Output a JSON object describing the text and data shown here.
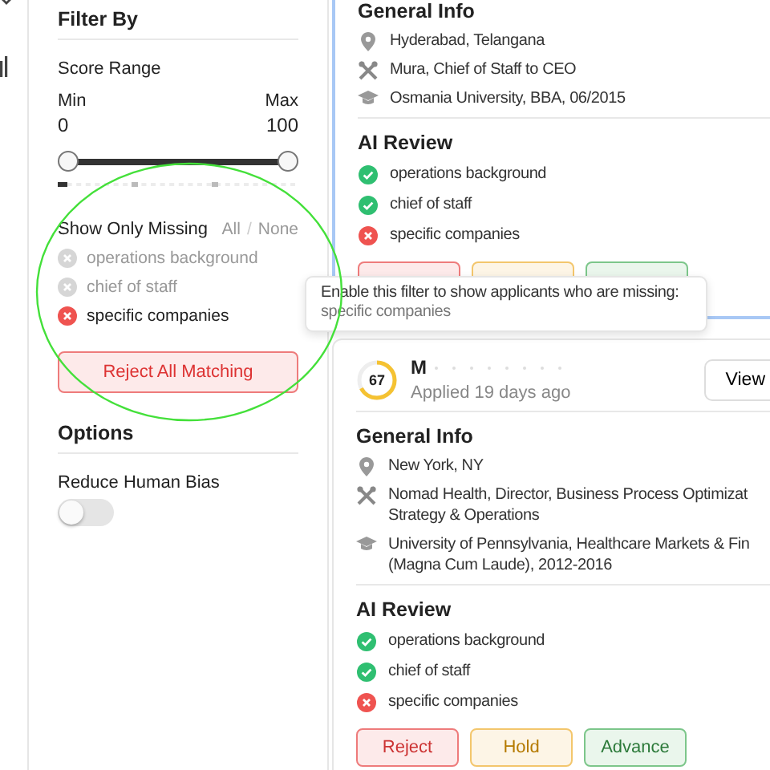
{
  "filter_panel": {
    "title": "Filter By",
    "score_range": {
      "label": "Score Range",
      "min_label": "Min",
      "max_label": "Max",
      "min_value": "0",
      "max_value": "100",
      "low_thumb": {
        "level": 0
      },
      "high_thumb": {
        "level": 1
      }
    },
    "missing_filter": {
      "label": "Show Only Missing",
      "all_link": "All",
      "separator": "/",
      "none_link": "None",
      "items": [
        {
          "label": "operations background",
          "selected": false
        },
        {
          "label": "chief of staff",
          "selected": false
        },
        {
          "label": "specific companies",
          "selected": true
        }
      ],
      "reject_button": "Reject All Matching"
    },
    "options": {
      "title": "Options",
      "toggles": [
        {
          "label": "Reduce Human Bias",
          "on": false
        }
      ]
    }
  },
  "tooltip": {
    "text": "Enable this filter to show applicants who are missing:",
    "detail": "specific companies"
  },
  "candidates": [
    {
      "selected": true,
      "general_info_title": "General Info",
      "info": [
        {
          "kind": "location",
          "lines": [
            "Hyderabad, Telangana"
          ]
        },
        {
          "kind": "work",
          "lines": [
            "Mura, Chief of Staff to CEO"
          ]
        },
        {
          "kind": "education",
          "lines": [
            "Osmania University, BBA, 06/2015"
          ]
        }
      ],
      "ai_review_title": "AI Review",
      "review": [
        {
          "label": "operations background",
          "passed": true
        },
        {
          "label": "chief of staff",
          "passed": true
        },
        {
          "label": "specific companies",
          "passed": false
        }
      ],
      "actions": [
        {
          "kind": "reject"
        },
        {
          "kind": "hold"
        },
        {
          "kind": "advance"
        }
      ]
    },
    {
      "selected": false,
      "score": {
        "value": "67",
        "level": 0.67
      },
      "name": "M",
      "applied": "Applied 19 days ago",
      "view_button": "View",
      "general_info_title": "General Info",
      "info": [
        {
          "kind": "location",
          "lines": [
            "New York, NY"
          ]
        },
        {
          "kind": "work",
          "lines": [
            "Nomad Health, Director, Business Process Optimizat",
            "Strategy & Operations"
          ]
        },
        {
          "kind": "education",
          "lines": [
            "University of Pennsylvania, Healthcare Markets & Fin",
            "(Magna Cum Laude), 2012-2016"
          ]
        }
      ],
      "ai_review_title": "AI Review",
      "review": [
        {
          "label": "operations background",
          "passed": true
        },
        {
          "label": "chief of staff",
          "passed": true
        },
        {
          "label": "specific companies",
          "passed": false
        }
      ],
      "actions": [
        {
          "kind": "reject",
          "label": "Reject"
        },
        {
          "kind": "hold",
          "label": "Hold"
        },
        {
          "kind": "advance",
          "label": "Advance"
        }
      ]
    }
  ]
}
